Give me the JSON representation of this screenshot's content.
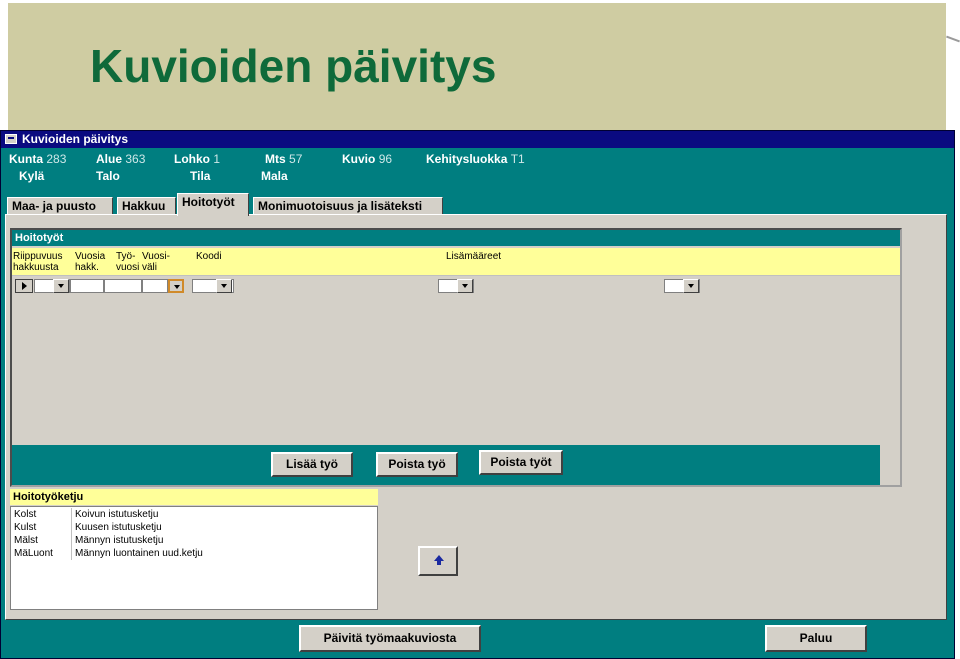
{
  "slide": {
    "title": "Kuvioiden päivitys"
  },
  "window": {
    "title": "Kuvioiden päivitys"
  },
  "info_row1": [
    {
      "label": "Kunta",
      "value": "283"
    },
    {
      "label": "Alue",
      "value": "363"
    },
    {
      "label": "Lohko",
      "value": "1"
    },
    {
      "label": "Mts",
      "value": "57"
    },
    {
      "label": "Kuvio",
      "value": "96"
    },
    {
      "label": "Kehitysluokka",
      "value": "T1"
    }
  ],
  "info_row2": [
    {
      "label": "Kylä",
      "value": ""
    },
    {
      "label": "Talo",
      "value": ""
    },
    {
      "label": "Tila",
      "value": ""
    },
    {
      "label": "Mala",
      "value": ""
    }
  ],
  "tabs": [
    {
      "label": "Maa- ja puusto"
    },
    {
      "label": "Hakkuu"
    },
    {
      "label": "Hoitotyöt"
    },
    {
      "label": "Monimuotoisuus ja lisäteksti"
    }
  ],
  "subform": {
    "title": "Hoitotyöt",
    "columns": {
      "riippuvuus": "Riippuvuus\nhakkuusta",
      "vuosia": "Vuosia\nhakk.",
      "tyovuosi": "Työ-\nvuosi",
      "vuosivali": "Vuosi-\nväli",
      "koodi": "Koodi",
      "lisamaareet": "Lisämääreet"
    }
  },
  "buttons": {
    "lisaa": "Lisää työ",
    "poista": "Poista työ",
    "poista_tyot": "Poista työt",
    "paivita": "Päivitä työmaakuviosta",
    "paluu": "Paluu"
  },
  "chain": {
    "label": "Hoitotyöketju",
    "items": [
      {
        "code": "Kolst",
        "name": "Koivun istutusketju"
      },
      {
        "code": "Kulst",
        "name": "Kuusen istutusketju"
      },
      {
        "code": "Mälst",
        "name": "Männyn istutusketju"
      },
      {
        "code": "MäLuont",
        "name": "Männyn luontainen uud.ketju"
      }
    ]
  },
  "colors": {
    "teal": "#007e80",
    "titlebar": "#0a0a80",
    "header_bg": "#cfcca2",
    "title_green": "#0f6a3a",
    "yellow": "#ffff99"
  }
}
